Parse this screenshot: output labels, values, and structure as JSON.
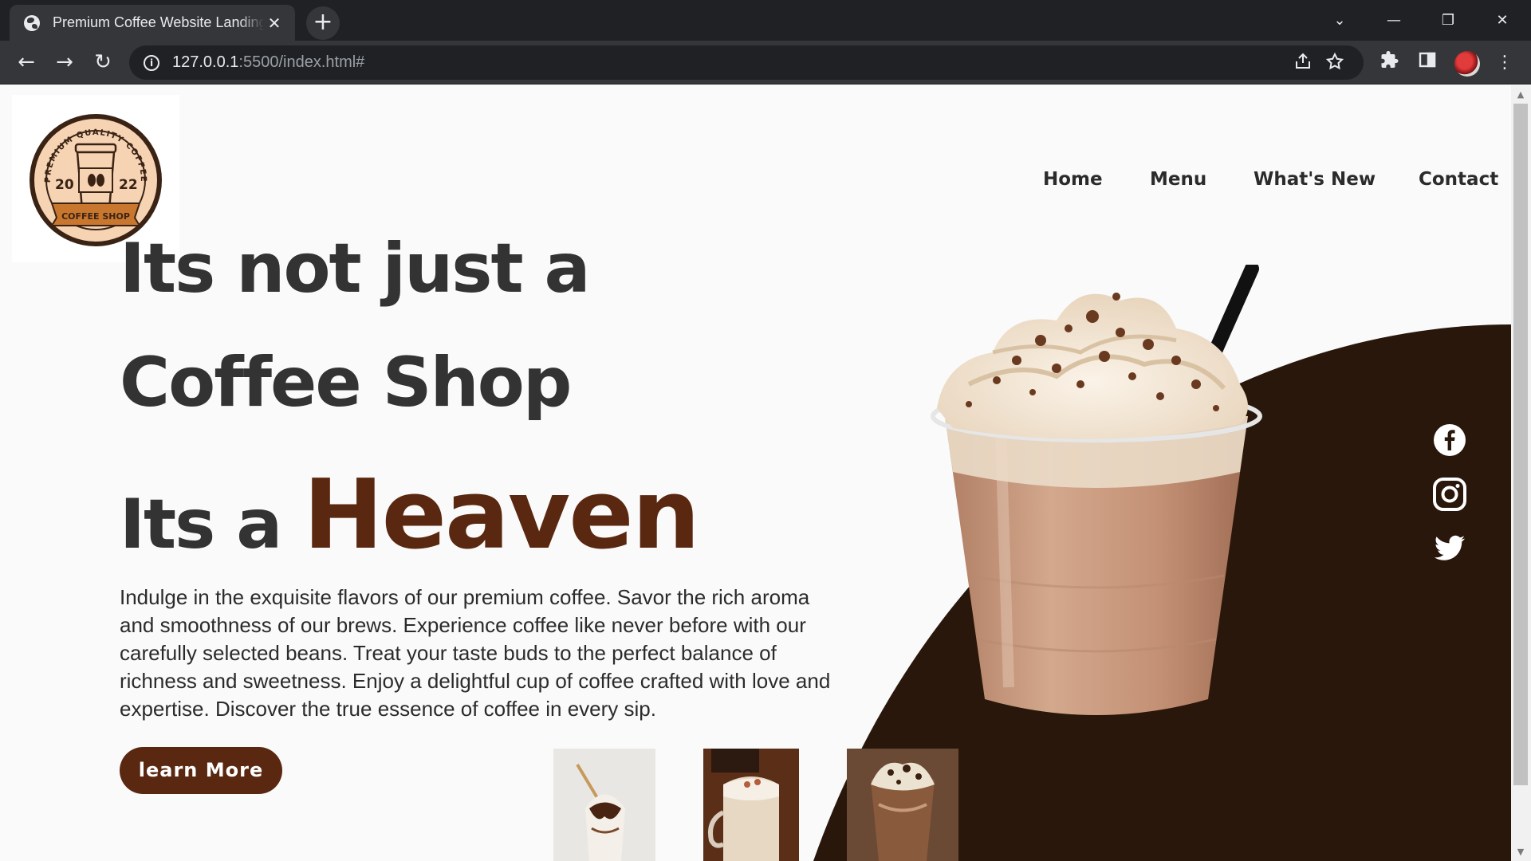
{
  "browser": {
    "tab_title": "Premium Coffee Website Landing Page",
    "tab_close": "✕",
    "new_tab": "+",
    "url_host": "127.0.0.1",
    "url_rest": ":5500/index.html#",
    "window_controls": {
      "dropdown": "⌄",
      "minimize": "—",
      "restore": "❐",
      "close": "✕"
    },
    "nav": {
      "back": "←",
      "forward": "→",
      "reload": "↻"
    },
    "icons": [
      "share-icon",
      "star-icon",
      "extensions-icon",
      "sidepanel-icon",
      "profile-avatar",
      "menu-icon"
    ]
  },
  "site": {
    "nav": [
      {
        "label": "Home"
      },
      {
        "label": "Menu"
      },
      {
        "label": "What's New"
      },
      {
        "label": "Contact"
      }
    ],
    "logo": {
      "ring_text": "PREMIUM QUALITY COFFEE",
      "year_left": "20",
      "year_right": "22",
      "banner": "COFFEE SHOP"
    },
    "hero": {
      "line1": "Its not just a",
      "line2": "Coffee Shop",
      "line3_prefix": "Its a",
      "line3_highlight": "Heaven",
      "description": "Indulge in the exquisite flavors of our premium coffee. Savor the rich aroma and smoothness of our brews. Experience coffee like never before with our carefully selected beans. Treat your taste buds to the perfect balance of richness and sweetness. Enjoy a delightful cup of coffee crafted with love and expertise. Discover the true essence of coffee in every sip.",
      "cta": "learn More"
    },
    "social": [
      "facebook-icon",
      "instagram-icon",
      "twitter-icon"
    ],
    "colors": {
      "brand_brown": "#5a2810",
      "dark_swoosh": "#2a170b",
      "heading": "#333333",
      "background": "#fafafa"
    }
  }
}
